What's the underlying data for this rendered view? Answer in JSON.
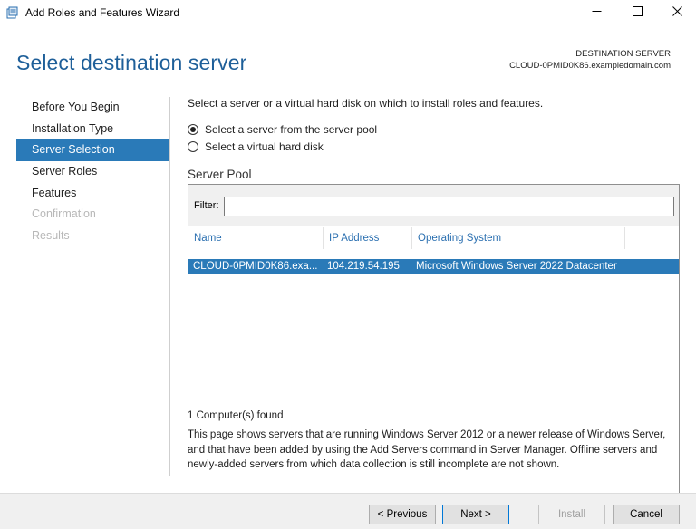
{
  "window": {
    "title": "Add Roles and Features Wizard",
    "icon": "server-manager-icon",
    "controls": [
      "minimize-icon",
      "maximize-icon",
      "close-icon"
    ]
  },
  "header": {
    "page_title": "Select destination server",
    "destination_label": "DESTINATION SERVER",
    "destination_server": "CLOUD-0PMID0K86.exampledomain.com"
  },
  "nav": {
    "items": [
      {
        "label": "Before You Begin",
        "state": "normal"
      },
      {
        "label": "Installation Type",
        "state": "normal"
      },
      {
        "label": "Server Selection",
        "state": "active"
      },
      {
        "label": "Server Roles",
        "state": "normal"
      },
      {
        "label": "Features",
        "state": "normal"
      },
      {
        "label": "Confirmation",
        "state": "disabled"
      },
      {
        "label": "Results",
        "state": "disabled"
      }
    ]
  },
  "content": {
    "intro": "Select a server or a virtual hard disk on which to install roles and features.",
    "options": [
      {
        "label": "Select a server from the server pool",
        "selected": true
      },
      {
        "label": "Select a virtual hard disk",
        "selected": false
      }
    ],
    "pool_title": "Server Pool",
    "filter_label": "Filter:",
    "filter_value": "",
    "columns": [
      "Name",
      "IP Address",
      "Operating System"
    ],
    "rows": [
      {
        "name": "CLOUD-0PMID0K86.exa...",
        "ip": "104.219.54.195",
        "os": "Microsoft Windows Server 2022 Datacenter",
        "selected": true
      }
    ],
    "found": "1 Computer(s) found",
    "description": "This page shows servers that are running Windows Server 2012 or a newer release of Windows Server, and that have been added by using the Add Servers command in Server Manager. Offline servers and newly-added servers from which data collection is still incomplete are not shown."
  },
  "footer": {
    "previous": "< Previous",
    "next": "Next >",
    "install": "Install",
    "cancel": "Cancel"
  },
  "colors": {
    "accent": "#2a7ab8",
    "title_blue": "#1e5f99",
    "header_link": "#2a6fb0",
    "disabled_text": "#b8b8b8"
  }
}
